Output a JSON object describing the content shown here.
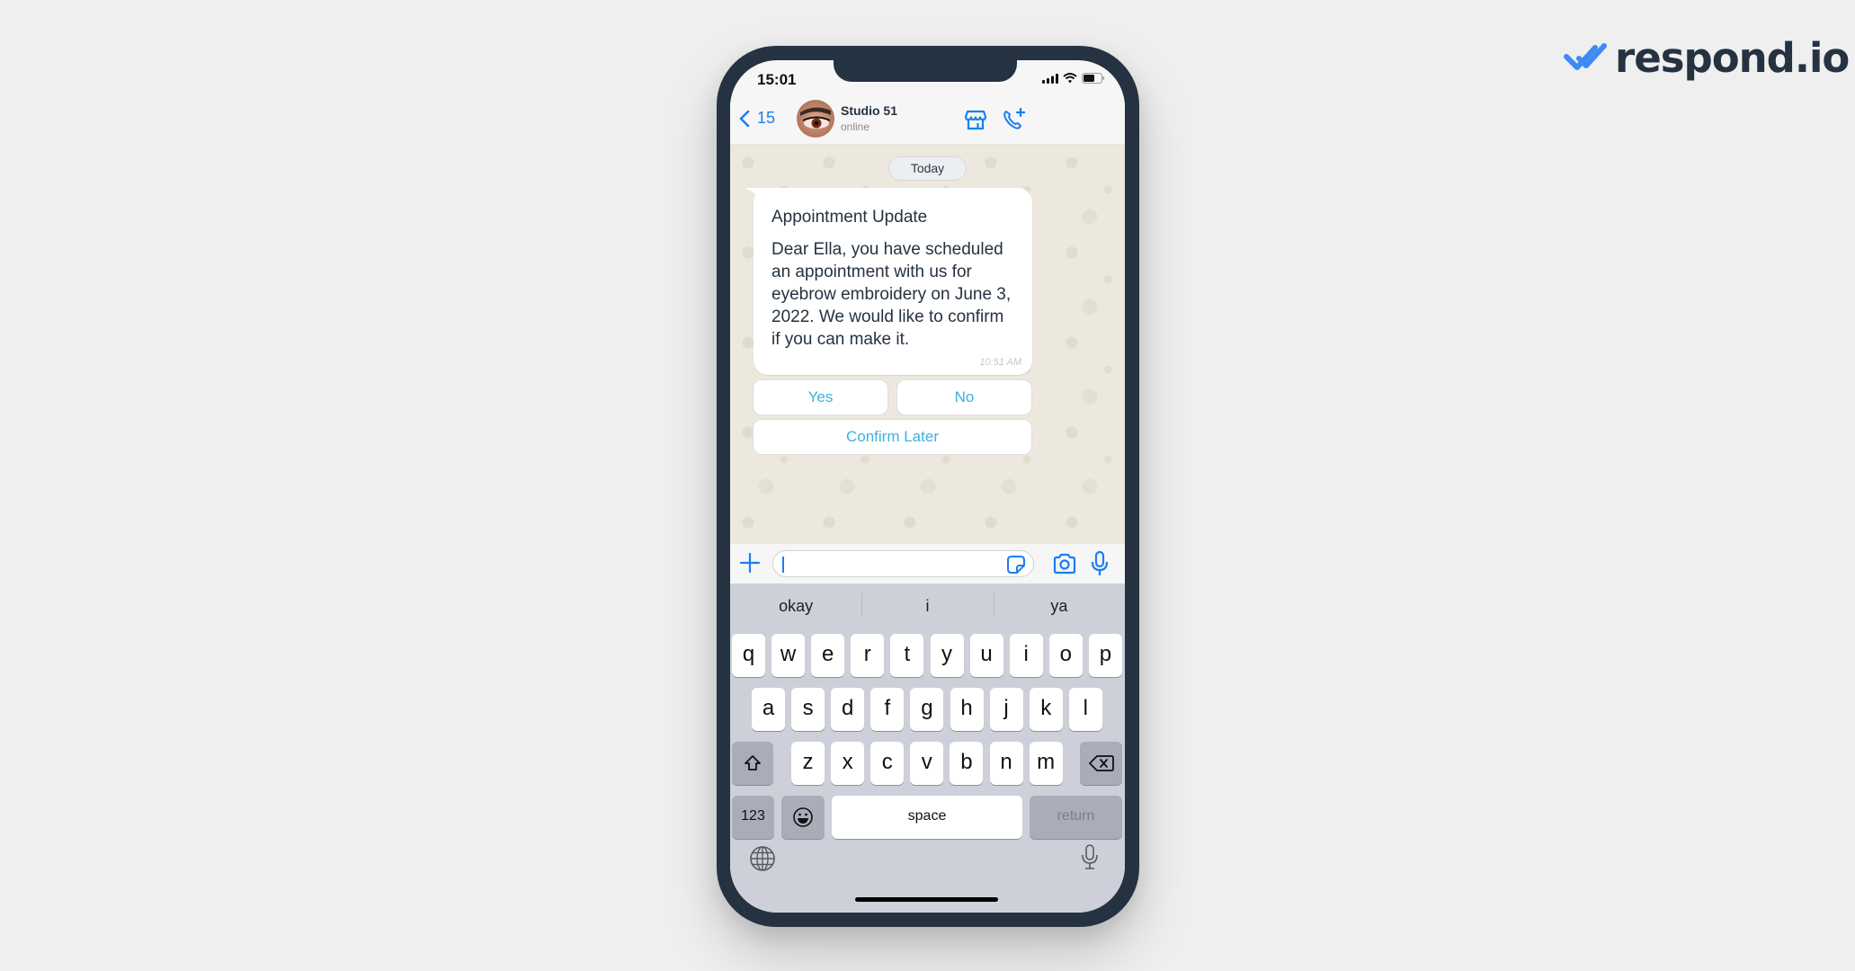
{
  "brand": {
    "logo_text": "respond.io",
    "accent": "#3e8af5",
    "dark": "#253241"
  },
  "status_bar": {
    "time": "15:01"
  },
  "chat_header": {
    "back_count": "15",
    "contact_name": "Studio 51",
    "contact_status": "online",
    "icons": [
      "chevron-left-icon",
      "store-icon",
      "add-call-icon"
    ]
  },
  "chat": {
    "date_label": "Today",
    "message": {
      "title": "Appointment Update",
      "body": "Dear Ella, you have scheduled an appointment with us for eyebrow embroidery on June 3, 2022. We would like to confirm if you can make it.",
      "time": "10:51 AM"
    },
    "quick_replies": [
      "Yes",
      "No",
      "Confirm Later"
    ]
  },
  "composer": {
    "value": "",
    "icons": [
      "plus-icon",
      "sticker-icon",
      "camera-icon",
      "microphone-icon"
    ]
  },
  "keyboard": {
    "suggestions": [
      "okay",
      "i",
      "ya"
    ],
    "row1": [
      "q",
      "w",
      "e",
      "r",
      "t",
      "y",
      "u",
      "i",
      "o",
      "p"
    ],
    "row2": [
      "a",
      "s",
      "d",
      "f",
      "g",
      "h",
      "j",
      "k",
      "l"
    ],
    "row3": [
      "z",
      "x",
      "c",
      "v",
      "b",
      "n",
      "m"
    ],
    "numbers_label": "123",
    "space_label": "space",
    "return_label": "return"
  }
}
